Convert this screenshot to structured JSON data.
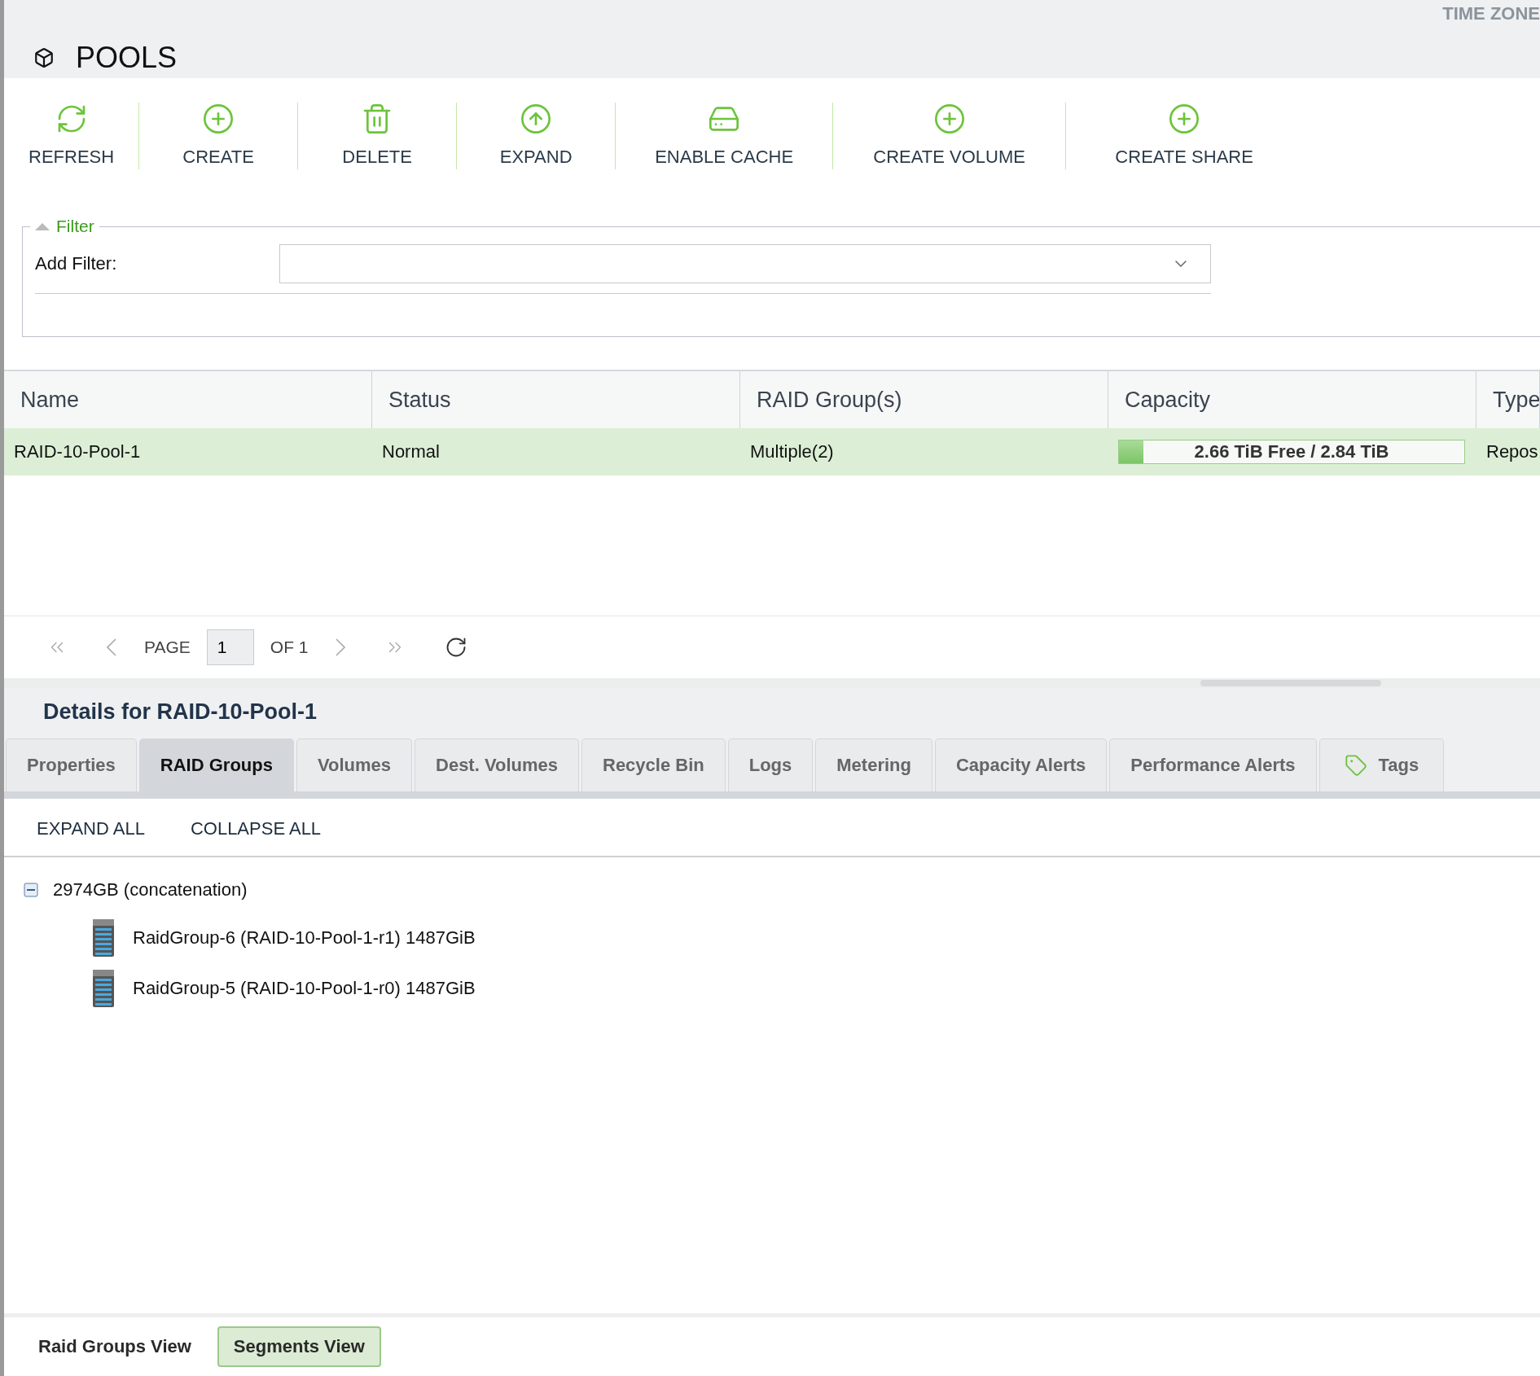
{
  "header": {
    "top_right": "TIME ZONE",
    "title": "POOLS"
  },
  "toolbar": [
    {
      "kind": "refresh",
      "label": "REFRESH"
    },
    {
      "kind": "create",
      "label": "CREATE"
    },
    {
      "kind": "delete",
      "label": "DELETE"
    },
    {
      "kind": "expand",
      "label": "EXPAND"
    },
    {
      "kind": "cache",
      "label": "ENABLE CACHE"
    },
    {
      "kind": "create",
      "label": "CREATE VOLUME"
    },
    {
      "kind": "create",
      "label": "CREATE SHARE"
    }
  ],
  "filter": {
    "legend": "Filter",
    "expanded": true,
    "label": "Add Filter:"
  },
  "table": {
    "columns": [
      "Name",
      "Status",
      "RAID Group(s)",
      "Capacity",
      "Type"
    ],
    "rows": [
      {
        "selected": true,
        "name": "RAID-10-Pool-1",
        "status": "Normal",
        "raid_groups": "Multiple(2)",
        "capacity": {
          "text": "2.66 TiB Free / 2.84 TiB",
          "level": 0.07
        },
        "type": "Repos"
      }
    ]
  },
  "pager": {
    "page_label": "PAGE",
    "page": "1",
    "of": "OF 1"
  },
  "details": {
    "title": "Details for RAID-10-Pool-1",
    "tabs": [
      {
        "label": "Properties",
        "selected": false
      },
      {
        "label": "RAID Groups",
        "selected": true
      },
      {
        "label": "Volumes",
        "selected": false
      },
      {
        "label": "Dest. Volumes",
        "selected": false
      },
      {
        "label": "Recycle Bin",
        "selected": false
      },
      {
        "label": "Logs",
        "selected": false
      },
      {
        "label": "Metering",
        "selected": false
      },
      {
        "label": "Capacity Alerts",
        "selected": false
      },
      {
        "label": "Performance Alerts",
        "selected": false
      },
      {
        "label": "Tags",
        "selected": false,
        "kind": "tag"
      }
    ],
    "actions": [
      "EXPAND ALL",
      "COLLAPSE ALL"
    ],
    "tree": [
      {
        "label": "2974GB (concatenation)",
        "expanded": true,
        "children": [
          {
            "label": "RaidGroup-6 (RAID-10-Pool-1-r1) 1487GiB"
          },
          {
            "label": "RaidGroup-5 (RAID-10-Pool-1-r0) 1487GiB"
          }
        ]
      }
    ]
  },
  "views": [
    {
      "label": "Raid Groups View",
      "selected": false
    },
    {
      "label": "Segments View",
      "selected": true
    }
  ]
}
